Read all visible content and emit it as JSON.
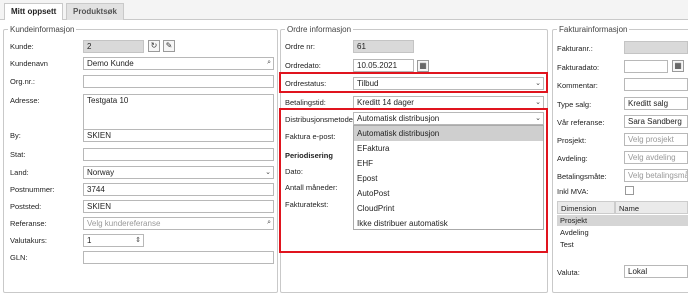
{
  "tabs": [
    "Mitt oppsett",
    "Produktsøk"
  ],
  "kunde": {
    "legend": "Kundeinformasjon",
    "labels": {
      "kunde": "Kunde:",
      "kundenavn": "Kundenavn",
      "orgnr": "Org.nr.:",
      "adresse": "Adresse:",
      "by": "By:",
      "stat": "Stat:",
      "land": "Land:",
      "postnummer": "Postnummer:",
      "poststed": "Poststed:",
      "referanse": "Referanse:",
      "valutakurs": "Valutakurs:",
      "gln": "GLN:"
    },
    "values": {
      "kunde": "2",
      "kundenavn": "Demo Kunde",
      "adresse": "Testgata 10",
      "by": "SKIEN",
      "land": "Norway",
      "postnummer": "3744",
      "poststed": "SKIEN",
      "valutakurs": "1"
    },
    "placeholders": {
      "referanse": "Velg kundereferanse"
    }
  },
  "ordre": {
    "legend": "Ordre informasjon",
    "labels": {
      "ordrenr": "Ordre nr:",
      "ordredato": "Ordredato:",
      "ordrestatus": "Ordrestatus:",
      "betalingstid": "Betalingstid:",
      "distribusjon": "Distribusjonsmetode:",
      "epost": "Faktura e-post:",
      "periodisering": "Periodisering",
      "dato": "Dato:",
      "antall": "Antall måneder:",
      "fakturatekst": "Fakturatekst:"
    },
    "values": {
      "ordrenr": "61",
      "ordredato": "10.05.2021",
      "ordrestatus": "Tilbud",
      "betalingstid": "Kreditt 14 dager",
      "distribusjon": "Automatisk distribusjon"
    },
    "distribution_options": [
      "Automatisk distribusjon",
      "EFaktura",
      "EHF",
      "Epost",
      "AutoPost",
      "CloudPrint",
      "Ikke distribuer automatisk"
    ]
  },
  "faktura": {
    "legend": "Fakturainformasjon",
    "labels": {
      "fakturanr": "Fakturanr.:",
      "fakturadato": "Fakturadato:",
      "kommentar": "Kommentar:",
      "typesalg": "Type salg:",
      "varref": "Vår referanse:",
      "prosjekt": "Prosjekt:",
      "avdeling": "Avdeling:",
      "betalingsmate": "Betalingsmåte:",
      "inklmva": "Inkl MVA:",
      "valuta": "Valuta:"
    },
    "values": {
      "typesalg": "Kreditt salg",
      "varref": "Sara  Sandberg",
      "valuta": "Lokal"
    },
    "placeholders": {
      "prosjekt": "Velg prosjekt",
      "avdeling": "Velg avdeling",
      "betalingsmate": "Velg betalingsmåte"
    },
    "table": {
      "headers": [
        "Dimension",
        "Name"
      ],
      "rows": [
        "Prosjekt",
        "Avdeling",
        "Test"
      ]
    }
  },
  "colors": {
    "highlight": "#e0141e",
    "selected_row": "#cfcfcf"
  }
}
